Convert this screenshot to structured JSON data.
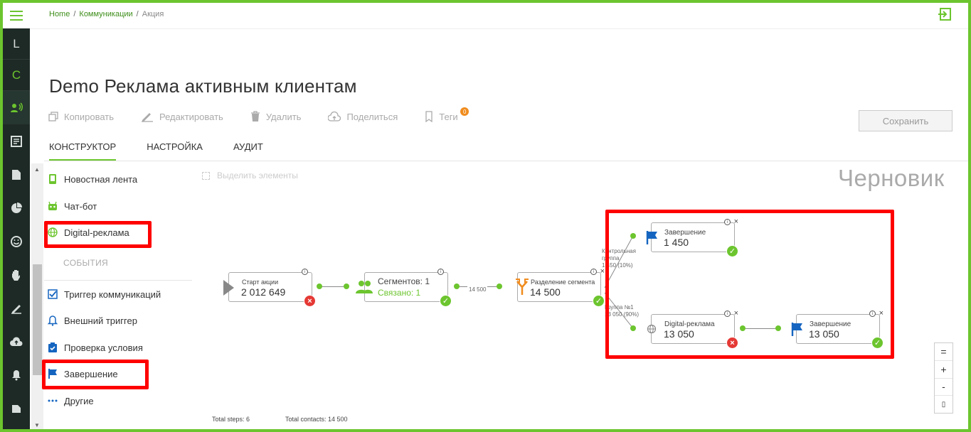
{
  "breadcrumb": {
    "home": "Home",
    "communications": "Коммуникации",
    "current": "Акция"
  },
  "rail": {
    "letter_l": "L",
    "letter_c": "C"
  },
  "page": {
    "title": "Demo Реклама активным клиентам",
    "draft": "Черновик"
  },
  "toolbar": {
    "copy": "Копировать",
    "edit": "Редактировать",
    "delete": "Удалить",
    "share": "Поделиться",
    "tags": "Теги",
    "tags_count": "0",
    "save": "Сохранить"
  },
  "tabs": [
    "КОНСТРУКТОР",
    "НАСТРОЙКА",
    "АУДИТ"
  ],
  "palette": {
    "items_top": [
      "Новостная лента",
      "Чат-бот",
      "Digital-реклама"
    ],
    "section_events": "СОБЫТИЯ",
    "items_events": [
      "Триггер коммуникаций",
      "Внешний триггер",
      "Проверка условия",
      "Завершение",
      "Другие"
    ]
  },
  "canvas": {
    "select_elements": "Выделить элементы",
    "nodes": {
      "start": {
        "label": "Старт акции",
        "value": "2 012 649"
      },
      "segments": {
        "label": "Сегментов: 1",
        "linked": "Связано: 1"
      },
      "split": {
        "label": "Разделение сегмента",
        "value": "14 500"
      },
      "end_control": {
        "label": "Завершение",
        "value": "1 450"
      },
      "digital": {
        "label": "Digital-реклама",
        "value": "13 050"
      },
      "end_main": {
        "label": "Завершение",
        "value": "13 050"
      }
    },
    "edge_label": "14 500",
    "branch_control": [
      "Контрольная",
      "группа",
      "1 450 (10%)"
    ],
    "branch_group": [
      "Группа №1",
      "13 050 (90%)"
    ],
    "info_glyph": "i",
    "close_glyph": "×",
    "ok_glyph": "✓",
    "err_glyph": "×"
  },
  "footer": {
    "total_steps": "Total steps: 6",
    "total_contacts": "Total contacts: 14 500"
  },
  "zoom": {
    "fit": "=",
    "in": "+",
    "out": "-",
    "full": "▯"
  },
  "colors": {
    "accent": "#6cc52e",
    "rail": "#1e2a26",
    "highlight": "#ff0000",
    "flag": "#1565c0",
    "error": "#e53935"
  }
}
